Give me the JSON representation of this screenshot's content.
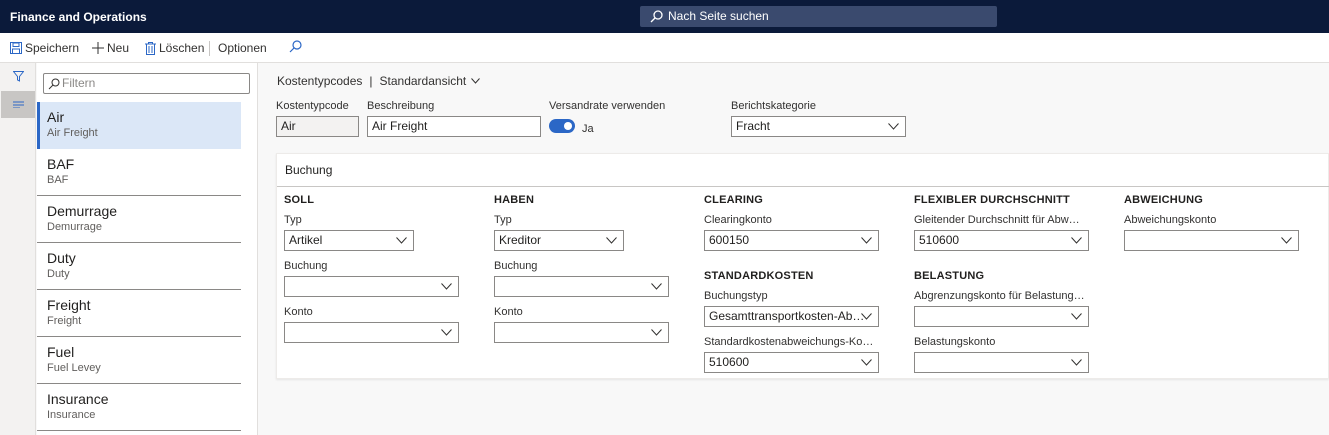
{
  "app": {
    "title": "Finance and Operations"
  },
  "search": {
    "label": "Nach Seite suchen"
  },
  "actions": {
    "save": "Speichern",
    "new": "Neu",
    "delete": "Löschen",
    "options": "Optionen"
  },
  "filter": {
    "placeholder": "Filtern"
  },
  "list": [
    {
      "title": "Air",
      "subtitle": "Air Freight"
    },
    {
      "title": "BAF",
      "subtitle": "BAF"
    },
    {
      "title": "Demurrage",
      "subtitle": "Demurrage"
    },
    {
      "title": "Duty",
      "subtitle": "Duty"
    },
    {
      "title": "Freight",
      "subtitle": "Freight"
    },
    {
      "title": "Fuel",
      "subtitle": "Fuel Levey"
    },
    {
      "title": "Insurance",
      "subtitle": "Insurance"
    }
  ],
  "breadcrumb": {
    "page": "Kostentypcodes",
    "separator": "|",
    "view": "Standardansicht"
  },
  "header": {
    "code_label": "Kostentypcode",
    "code_value": "Air",
    "desc_label": "Beschreibung",
    "desc_value": "Air Freight",
    "rate_label": "Versandrate verwenden",
    "rate_value": "Ja",
    "cat_label": "Berichtskategorie",
    "cat_value": "Fracht"
  },
  "posting": {
    "title": "Buchung",
    "soll": {
      "heading": "SOLL",
      "type_label": "Typ",
      "type_value": "Artikel",
      "posting_label": "Buchung",
      "posting_value": "",
      "account_label": "Konto",
      "account_value": ""
    },
    "haben": {
      "heading": "HABEN",
      "type_label": "Typ",
      "type_value": "Kreditor",
      "posting_label": "Buchung",
      "posting_value": "",
      "account_label": "Konto",
      "account_value": ""
    },
    "clearing": {
      "heading": "CLEARING",
      "account_label": "Clearingkonto",
      "account_value": "600150"
    },
    "standard": {
      "heading": "STANDARDKOSTEN",
      "type_label": "Buchungstyp",
      "type_value": "Gesamttransportkosten-Ab…",
      "variance_label": "Standardkostenabweichungs-Ko…",
      "variance_value": "510600"
    },
    "flex": {
      "heading": "FLEXIBLER DURCHSCHNITT",
      "account_label": "Gleitender Durchschnitt für Abw…",
      "account_value": "510600"
    },
    "charge": {
      "heading": "BELASTUNG",
      "accrual_label": "Abgrenzungskonto für Belastung…",
      "accrual_value": "",
      "account_label": "Belastungskonto",
      "account_value": ""
    },
    "variance": {
      "heading": "ABWEICHUNG",
      "account_label": "Abweichungskonto",
      "account_value": ""
    }
  },
  "colors": {
    "topbar": "#0b1a3a",
    "accent": "#2b67c6",
    "selected": "#dbe7f7"
  }
}
